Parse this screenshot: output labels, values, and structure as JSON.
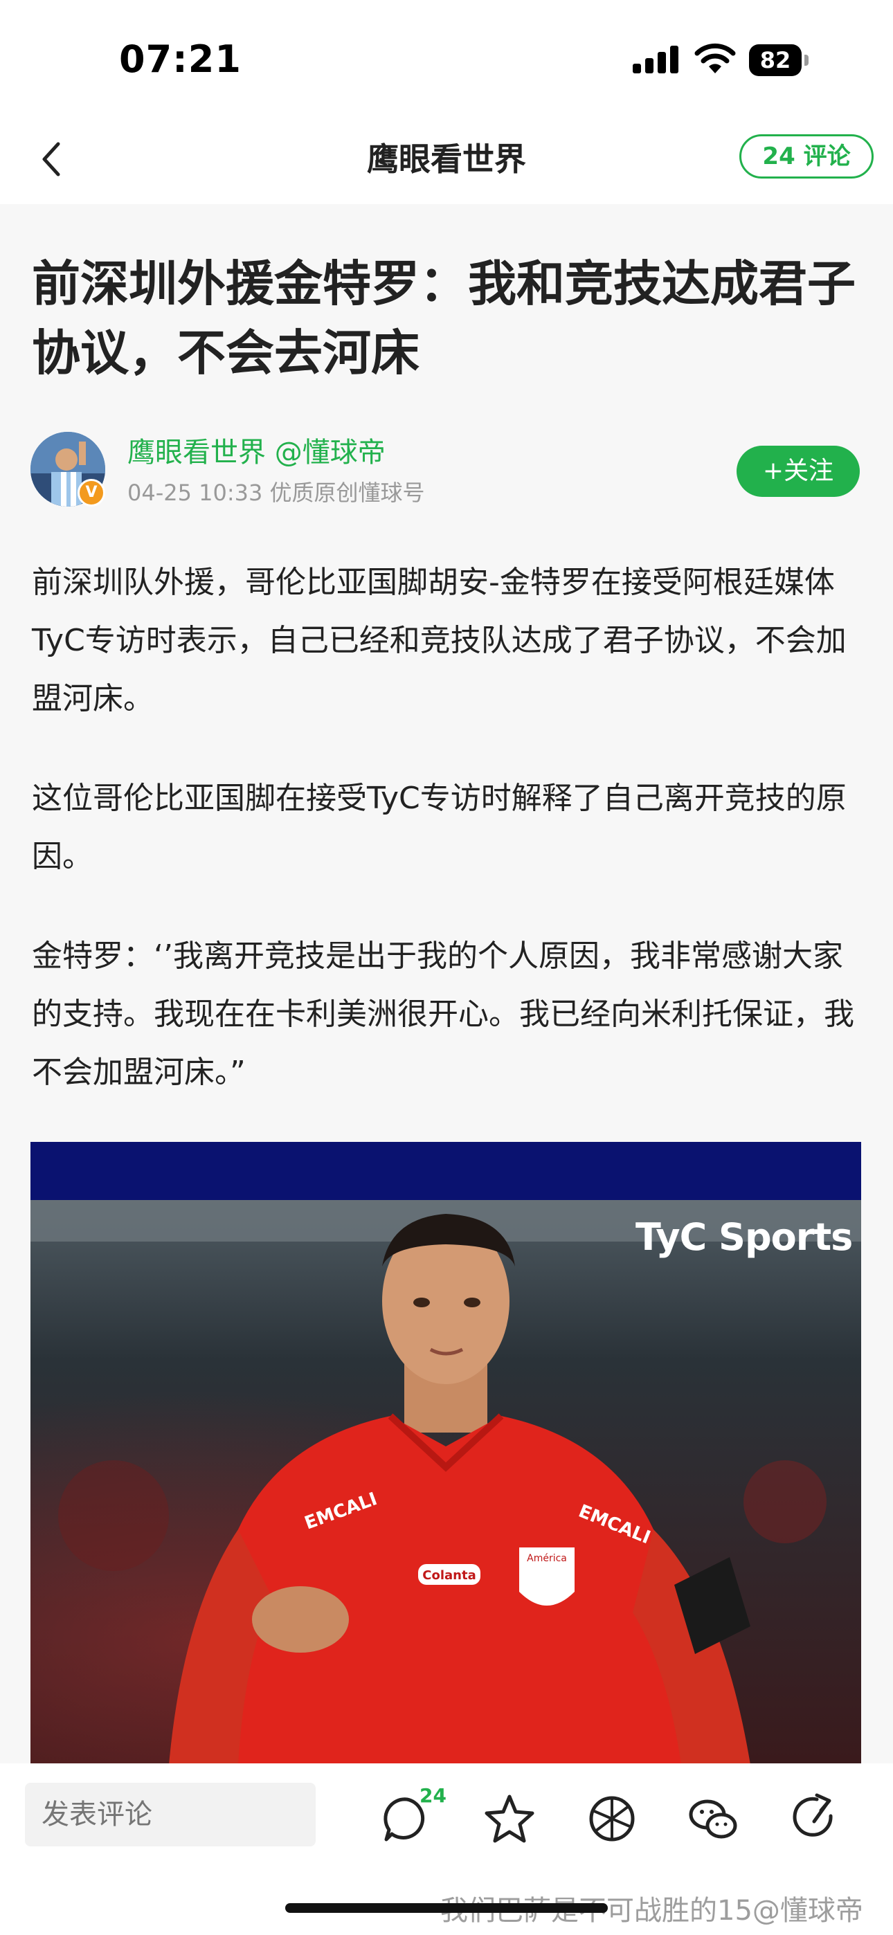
{
  "status_bar": {
    "time": "07:21",
    "battery_level": "82"
  },
  "nav": {
    "title": "鹰眼看世界",
    "comments_button": "24 评论"
  },
  "article": {
    "title": "前深圳外援金特罗：我和竞技达成君子协议，不会去河床",
    "author": {
      "name": "鹰眼看世界 @懂球帝",
      "meta": "04-25 10:33  优质原创懂球号",
      "verified_badge": "V",
      "follow_label": "+关注"
    },
    "paragraphs": [
      "前深圳队外援，哥伦比亚国脚胡安-金特罗在接受阿根廷媒体TyC专访时表示，自己已经和竞技队达成了君子协议，不会加盟河床。",
      "这位哥伦比亚国脚在接受TyC专访时解释了自己离开竞技的原因。",
      "金特罗：‘’我离开竞技是出于我的个人原因，我非常感谢大家的支持。我现在在卡利美洲很开心。我已经向米利托保证，我不会加盟河床。”"
    ],
    "photo": {
      "watermark_logo": "TyC Sports",
      "shirt_sponsor": "Colanta",
      "sleeve_text": "EMCALI",
      "crest_text": "América"
    }
  },
  "bottom_bar": {
    "comment_placeholder": "发表评论",
    "comment_count": "24",
    "icons": [
      "comment-icon",
      "star-icon",
      "moments-icon",
      "wechat-icon",
      "share-icon"
    ]
  },
  "watermark": "我们巴萨是不可战胜的15@懂球帝",
  "colors": {
    "accent": "#22b14c",
    "badge": "#f39a1e",
    "jersey": "#e0241c"
  }
}
